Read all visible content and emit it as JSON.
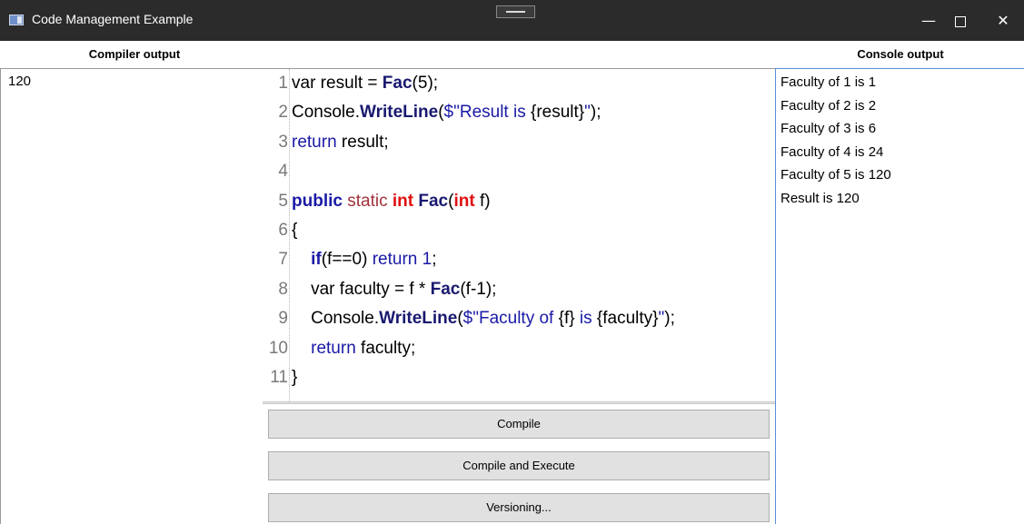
{
  "window": {
    "title": "Code Management Example",
    "controls": {
      "minimize": "—",
      "close": "✕"
    }
  },
  "headers": {
    "compiler_output": "Compiler output",
    "console_output": "Console output"
  },
  "compiler_output": {
    "text": "120"
  },
  "editor": {
    "lines": [
      {
        "n": "1",
        "tokens": [
          [
            "var result = ",
            "plain"
          ],
          [
            "Fac",
            "method"
          ],
          [
            "(5);",
            "plain"
          ]
        ]
      },
      {
        "n": "2",
        "tokens": [
          [
            "Console.",
            "plain"
          ],
          [
            "WriteLine",
            "method"
          ],
          [
            "(",
            "plain"
          ],
          [
            "$\"Result is ",
            "string"
          ],
          [
            "{result}",
            "plain"
          ],
          [
            "\"",
            "string"
          ],
          [
            ");",
            "plain"
          ]
        ]
      },
      {
        "n": "3",
        "tokens": [
          [
            "return",
            "keyword"
          ],
          [
            " result;",
            "plain"
          ]
        ]
      },
      {
        "n": "4",
        "tokens": []
      },
      {
        "n": "5",
        "tokens": [
          [
            "public",
            "keyword-bold"
          ],
          [
            " ",
            "plain"
          ],
          [
            "static",
            "modifier"
          ],
          [
            " ",
            "plain"
          ],
          [
            "int",
            "type"
          ],
          [
            " ",
            "plain"
          ],
          [
            "Fac",
            "method"
          ],
          [
            "(",
            "plain"
          ],
          [
            "int",
            "type"
          ],
          [
            " f)",
            "plain"
          ]
        ]
      },
      {
        "n": "6",
        "tokens": [
          [
            "{",
            "plain"
          ]
        ]
      },
      {
        "n": "7",
        "tokens": [
          [
            "    ",
            "plain"
          ],
          [
            "if",
            "keyword-bold"
          ],
          [
            "(f==0) ",
            "plain"
          ],
          [
            "return 1",
            "keyword"
          ],
          [
            ";",
            "plain"
          ]
        ]
      },
      {
        "n": "8",
        "tokens": [
          [
            "    var faculty = f * ",
            "plain"
          ],
          [
            "Fac",
            "method"
          ],
          [
            "(f-1);",
            "plain"
          ]
        ]
      },
      {
        "n": "9",
        "tokens": [
          [
            "    Console.",
            "plain"
          ],
          [
            "WriteLine",
            "method"
          ],
          [
            "(",
            "plain"
          ],
          [
            "$\"Faculty of ",
            "string"
          ],
          [
            "{f}",
            "plain"
          ],
          [
            " is ",
            "string"
          ],
          [
            "{faculty}",
            "plain"
          ],
          [
            "\"",
            "string"
          ],
          [
            ");",
            "plain"
          ]
        ]
      },
      {
        "n": "10",
        "tokens": [
          [
            "    ",
            "plain"
          ],
          [
            "return",
            "keyword"
          ],
          [
            " faculty;",
            "plain"
          ]
        ]
      },
      {
        "n": "11",
        "tokens": [
          [
            "}",
            "plain"
          ]
        ]
      }
    ]
  },
  "buttons": {
    "compile": "Compile",
    "compile_execute": "Compile and Execute",
    "versioning": "Versioning..."
  },
  "console": {
    "lines": [
      "Faculty of 1 is 1",
      "Faculty of 2 is 2",
      "Faculty of 3 is 6",
      "Faculty of 4 is 24",
      "Faculty of 5 is 120",
      "Result is 120"
    ]
  },
  "colors": {
    "titlebar": "#2b2b2b",
    "keyword": "#1a1aa6",
    "method": "#191970",
    "type": "#e01010",
    "modifier": "#a0323c",
    "button_bg": "#e1e1e1",
    "console_border": "#5a8fd6"
  }
}
